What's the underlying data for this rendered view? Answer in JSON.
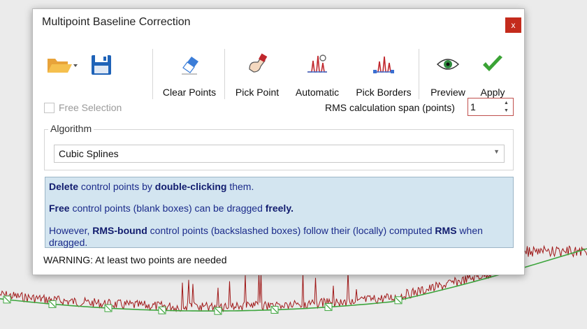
{
  "window": {
    "title": "Multipoint Baseline Correction",
    "close_glyph": "x"
  },
  "toolbar": {
    "open_icon": "folder-open-icon",
    "save_icon": "floppy-disk-icon",
    "tools": [
      {
        "label": "Clear Points",
        "icon": "eraser-icon"
      },
      {
        "label": "Pick Point",
        "icon": "hand-pointer-icon"
      },
      {
        "label": "Automatic",
        "icon": "auto-peaks-icon"
      },
      {
        "label": "Pick Borders",
        "icon": "peak-borders-icon"
      },
      {
        "label": "Preview",
        "icon": "eye-icon"
      },
      {
        "label": "Apply",
        "icon": "checkmark-icon"
      }
    ]
  },
  "options": {
    "free_selection_label": "Free Selection",
    "free_selection_checked": false,
    "rms_label": "RMS calculation span (points)",
    "rms_value": "1"
  },
  "algorithm": {
    "group_label": "Algorithm",
    "selected": "Cubic Splines"
  },
  "info": {
    "line1": {
      "b1": "Delete",
      "t1": " control points by ",
      "b2": "double-clicking",
      "t2": " them."
    },
    "line2": {
      "b1": "Free",
      "t1": " control points (blank boxes) can be dragged ",
      "b2": "freely."
    },
    "line3": {
      "t0": "However, ",
      "b1": "RMS-bound",
      "t1": " control points (backslashed boxes) follow their (locally) computed ",
      "b2": "RMS",
      "t2": " when dragged."
    }
  },
  "status": {
    "warning": "WARNING: At least two points are needed"
  },
  "colors": {
    "signal": "#a01818",
    "baseline": "#3da53d",
    "info_bg": "#d3e5f0",
    "close_bg": "#c42b1c",
    "apply_check": "#3aa335"
  }
}
